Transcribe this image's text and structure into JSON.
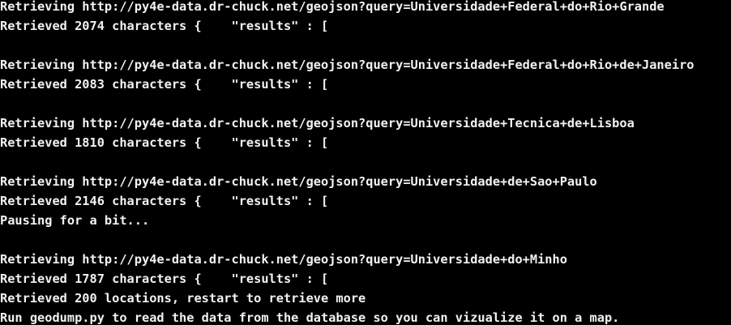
{
  "terminal": {
    "lines": [
      "Retrieving http://py4e-data.dr-chuck.net/geojson?query=Universidade+Federal+do+Rio+Grande",
      "Retrieved 2074 characters {    \"results\" : [",
      "",
      "Retrieving http://py4e-data.dr-chuck.net/geojson?query=Universidade+Federal+do+Rio+de+Janeiro",
      "Retrieved 2083 characters {    \"results\" : [",
      "",
      "Retrieving http://py4e-data.dr-chuck.net/geojson?query=Universidade+Tecnica+de+Lisboa",
      "Retrieved 1810 characters {    \"results\" : [",
      "",
      "Retrieving http://py4e-data.dr-chuck.net/geojson?query=Universidade+de+Sao+Paulo",
      "Retrieved 2146 characters {    \"results\" : [",
      "Pausing for a bit...",
      "",
      "Retrieving http://py4e-data.dr-chuck.net/geojson?query=Universidade+do+Minho",
      "Retrieved 1787 characters {    \"results\" : [",
      "Retrieved 200 locations, restart to retrieve more",
      "Run geodump.py to read the data from the database so you can vizualize it on a map."
    ]
  }
}
